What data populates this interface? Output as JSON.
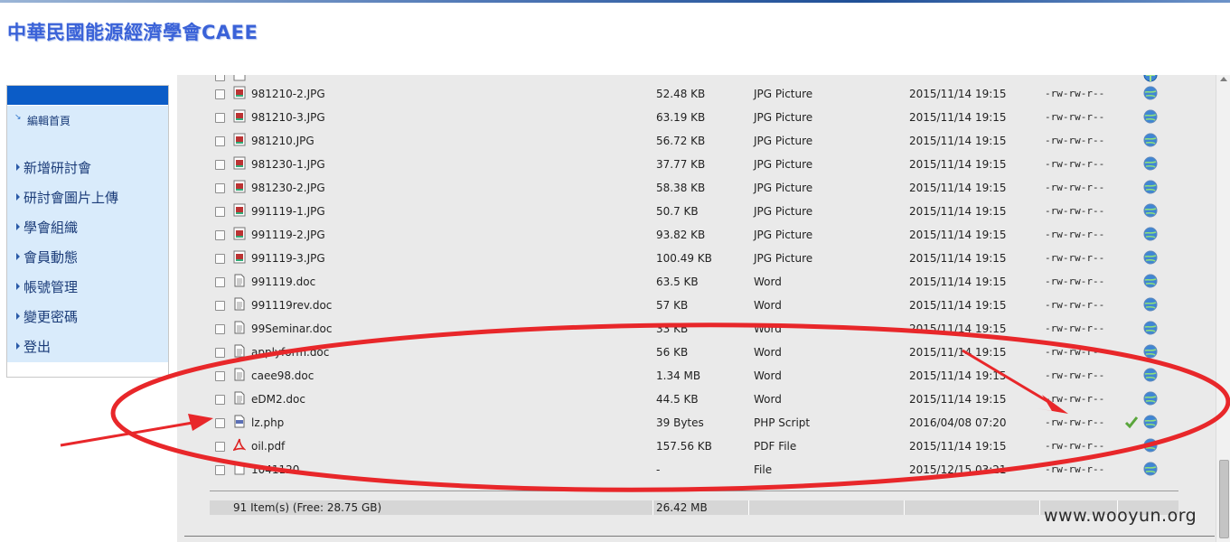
{
  "site": {
    "title": "中華民國能源經濟學會CAEE"
  },
  "sidebar": {
    "home_label": "編輯首頁",
    "items": [
      {
        "label": "新增研討會"
      },
      {
        "label": "研討會圖片上傳"
      },
      {
        "label": "學會組織"
      },
      {
        "label": "會員動態"
      },
      {
        "label": "帳號管理"
      },
      {
        "label": "變更密碼"
      },
      {
        "label": "登出"
      }
    ]
  },
  "files": [
    {
      "name": "981210-2.JPG",
      "size": "52.48 KB",
      "type": "JPG Picture",
      "date": "2015/11/14 19:15",
      "perm": "-rw-rw-r--",
      "icon": "image-file-icon"
    },
    {
      "name": "981210-3.JPG",
      "size": "63.19 KB",
      "type": "JPG Picture",
      "date": "2015/11/14 19:15",
      "perm": "-rw-rw-r--",
      "icon": "image-file-icon"
    },
    {
      "name": "981210.JPG",
      "size": "56.72 KB",
      "type": "JPG Picture",
      "date": "2015/11/14 19:15",
      "perm": "-rw-rw-r--",
      "icon": "image-file-icon"
    },
    {
      "name": "981230-1.JPG",
      "size": "37.77 KB",
      "type": "JPG Picture",
      "date": "2015/11/14 19:15",
      "perm": "-rw-rw-r--",
      "icon": "image-file-icon"
    },
    {
      "name": "981230-2.JPG",
      "size": "58.38 KB",
      "type": "JPG Picture",
      "date": "2015/11/14 19:15",
      "perm": "-rw-rw-r--",
      "icon": "image-file-icon"
    },
    {
      "name": "991119-1.JPG",
      "size": "50.7 KB",
      "type": "JPG Picture",
      "date": "2015/11/14 19:15",
      "perm": "-rw-rw-r--",
      "icon": "image-file-icon"
    },
    {
      "name": "991119-2.JPG",
      "size": "93.82 KB",
      "type": "JPG Picture",
      "date": "2015/11/14 19:15",
      "perm": "-rw-rw-r--",
      "icon": "image-file-icon"
    },
    {
      "name": "991119-3.JPG",
      "size": "100.49 KB",
      "type": "JPG Picture",
      "date": "2015/11/14 19:15",
      "perm": "-rw-rw-r--",
      "icon": "image-file-icon"
    },
    {
      "name": "991119.doc",
      "size": "63.5 KB",
      "type": "Word",
      "date": "2015/11/14 19:15",
      "perm": "-rw-rw-r--",
      "icon": "word-file-icon"
    },
    {
      "name": "991119rev.doc",
      "size": "57 KB",
      "type": "Word",
      "date": "2015/11/14 19:15",
      "perm": "-rw-rw-r--",
      "icon": "word-file-icon"
    },
    {
      "name": "99Seminar.doc",
      "size": "33 KB",
      "type": "Word",
      "date": "2015/11/14 19:15",
      "perm": "-rw-rw-r--",
      "icon": "word-file-icon"
    },
    {
      "name": "applyform.doc",
      "size": "56 KB",
      "type": "Word",
      "date": "2015/11/14 19:15",
      "perm": "-rw-rw-r--",
      "icon": "word-file-icon"
    },
    {
      "name": "caee98.doc",
      "size": "1.34 MB",
      "type": "Word",
      "date": "2015/11/14 19:15",
      "perm": "-rw-rw-r--",
      "icon": "word-file-icon"
    },
    {
      "name": "eDM2.doc",
      "size": "44.5 KB",
      "type": "Word",
      "date": "2015/11/14 19:15",
      "perm": "-rw-rw-r--",
      "icon": "word-file-icon"
    },
    {
      "name": "lz.php",
      "size": "39 Bytes",
      "type": "PHP Script",
      "date": "2016/04/08 07:20",
      "perm": "-rw-rw-r--",
      "icon": "php-file-icon"
    },
    {
      "name": "oil.pdf",
      "size": "157.56 KB",
      "type": "PDF File",
      "date": "2015/11/14 19:15",
      "perm": "-rw-rw-r--",
      "icon": "pdf-file-icon"
    },
    {
      "name": "1041120",
      "size": "-",
      "type": "File",
      "date": "2015/12/15 03:21",
      "perm": "-rw-rw-r--",
      "icon": "blank-file-icon"
    }
  ],
  "footer": {
    "items_label": "91 Item(s) (Free: 28.75 GB)",
    "total_size": "26.42 MB"
  },
  "watermark": "www.wooyun.org",
  "colors": {
    "title": "#3a62d8",
    "sidebar_head": "#0b5cc7",
    "sidebar_bg": "#d9ebfb",
    "annotation": "#e8272a"
  }
}
